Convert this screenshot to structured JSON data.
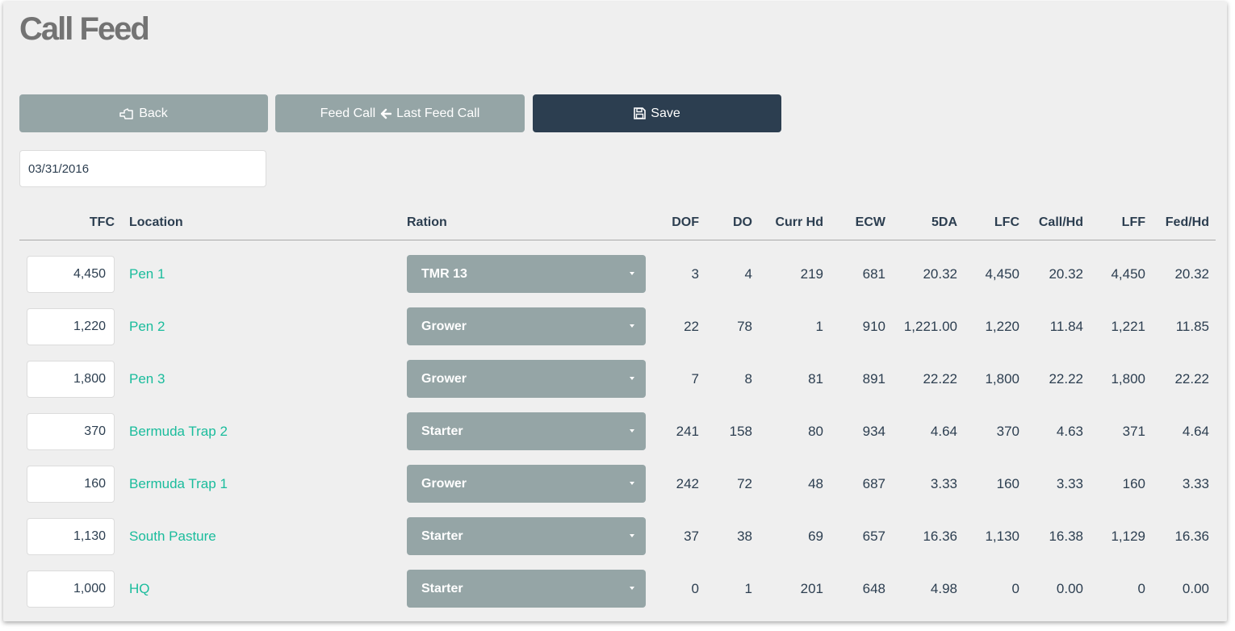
{
  "page": {
    "title": "Call Feed"
  },
  "buttons": {
    "back": "Back",
    "feed_call": "Feed Call",
    "last_feed_call": "Last Feed Call",
    "save": "Save"
  },
  "date": {
    "value": "03/31/2016"
  },
  "table": {
    "headers": {
      "tfc": "TFC",
      "location": "Location",
      "ration": "Ration",
      "dof": "DOF",
      "do": "DO",
      "curr_hd": "Curr Hd",
      "ecw": "ECW",
      "fda": "5DA",
      "lfc": "LFC",
      "call_hd": "Call/Hd",
      "lff": "LFF",
      "fed_hd": "Fed/Hd"
    },
    "rows": [
      {
        "tfc": "4,450",
        "location": "Pen 1",
        "ration": "TMR 13",
        "dof": "3",
        "do": "4",
        "curr_hd": "219",
        "ecw": "681",
        "fda": "20.32",
        "lfc": "4,450",
        "call_hd": "20.32",
        "lff": "4,450",
        "fed_hd": "20.32"
      },
      {
        "tfc": "1,220",
        "location": "Pen 2",
        "ration": "Grower",
        "dof": "22",
        "do": "78",
        "curr_hd": "1",
        "ecw": "910",
        "fda": "1,221.00",
        "lfc": "1,220",
        "call_hd": "11.84",
        "lff": "1,221",
        "fed_hd": "11.85"
      },
      {
        "tfc": "1,800",
        "location": "Pen 3",
        "ration": "Grower",
        "dof": "7",
        "do": "8",
        "curr_hd": "81",
        "ecw": "891",
        "fda": "22.22",
        "lfc": "1,800",
        "call_hd": "22.22",
        "lff": "1,800",
        "fed_hd": "22.22"
      },
      {
        "tfc": "370",
        "location": "Bermuda Trap 2",
        "ration": "Starter",
        "dof": "241",
        "do": "158",
        "curr_hd": "80",
        "ecw": "934",
        "fda": "4.64",
        "lfc": "370",
        "call_hd": "4.63",
        "lff": "371",
        "fed_hd": "4.64"
      },
      {
        "tfc": "160",
        "location": "Bermuda Trap 1",
        "ration": "Grower",
        "dof": "242",
        "do": "72",
        "curr_hd": "48",
        "ecw": "687",
        "fda": "3.33",
        "lfc": "160",
        "call_hd": "3.33",
        "lff": "160",
        "fed_hd": "3.33"
      },
      {
        "tfc": "1,130",
        "location": "South Pasture",
        "ration": "Starter",
        "dof": "37",
        "do": "38",
        "curr_hd": "69",
        "ecw": "657",
        "fda": "16.36",
        "lfc": "1,130",
        "call_hd": "16.38",
        "lff": "1,129",
        "fed_hd": "16.36"
      },
      {
        "tfc": "1,000",
        "location": "HQ",
        "ration": "Starter",
        "dof": "0",
        "do": "1",
        "curr_hd": "201",
        "ecw": "648",
        "fda": "4.98",
        "lfc": "0",
        "call_hd": "0.00",
        "lff": "0",
        "fed_hd": "0.00"
      }
    ]
  },
  "icons": {
    "back": "hand-pointing-left-icon",
    "last_feed_call": "arrow-left-icon",
    "save": "floppy-disk-icon",
    "ration_dropdown": "caret-down-icon"
  },
  "colors": {
    "link": "#1abc9c",
    "primary": "#2c3e50",
    "secondary": "#95a5a6",
    "background": "#efefef"
  }
}
